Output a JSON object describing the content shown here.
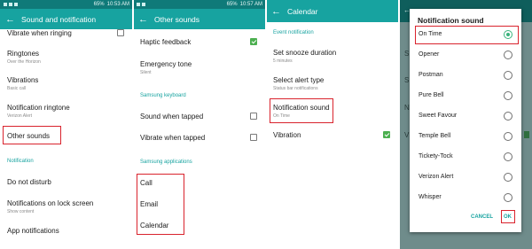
{
  "colors": {
    "status_bar": "#0f7a79",
    "app_bar": "#17a3a0",
    "accent": "#17a3a0",
    "highlight_box": "#d9232d",
    "checkbox_on": "#4caf50",
    "radio_on": "#3bb37d",
    "dim_overlay": "#6f8c8b"
  },
  "panel1": {
    "status": {
      "battery": "65%",
      "time": "10:53 AM"
    },
    "title": "Sound and notification",
    "back_icon": "arrow-left-icon",
    "rows": [
      {
        "label": "Vibrate when ringing",
        "sub": ""
      },
      {
        "label": "Ringtones",
        "sub": "Over the Horizon"
      },
      {
        "label": "Vibrations",
        "sub": "Basic call"
      },
      {
        "label": "Notification ringtone",
        "sub": "Verizon Alert"
      },
      {
        "label": "Other sounds",
        "sub": ""
      }
    ],
    "section": "Notification",
    "rows2": [
      {
        "label": "Do not disturb",
        "sub": ""
      },
      {
        "label": "Notifications on lock screen",
        "sub": "Show content"
      },
      {
        "label": "App notifications",
        "sub": ""
      }
    ]
  },
  "panel2": {
    "status": {
      "battery": "65%",
      "time": "10:57 AM"
    },
    "title": "Other sounds",
    "rows": [
      {
        "label": "Haptic feedback",
        "checked": true
      },
      {
        "label": "Emergency tone",
        "sub": "Silent"
      }
    ],
    "section_keyboard": "Samsung keyboard",
    "keyboard_rows": [
      {
        "label": "Sound when tapped",
        "checked": false
      },
      {
        "label": "Vibrate when tapped",
        "checked": false
      }
    ],
    "section_apps": "Samsung applications",
    "apps": [
      "Call",
      "Email",
      "Calendar"
    ]
  },
  "panel3": {
    "title": "Calendar",
    "section": "Event notification",
    "rows": [
      {
        "label": "Set snooze duration",
        "sub": "5 minutes"
      },
      {
        "label": "Select alert type",
        "sub": "Status bar notifications"
      },
      {
        "label": "Notification sound",
        "sub": "On Time"
      },
      {
        "label": "Vibration",
        "sub": "",
        "checked": true
      }
    ]
  },
  "panel4": {
    "dialog_title": "Notification sound",
    "options": [
      {
        "label": "On Time",
        "selected": true
      },
      {
        "label": "Opener",
        "selected": false
      },
      {
        "label": "Postman",
        "selected": false
      },
      {
        "label": "Pure Bell",
        "selected": false
      },
      {
        "label": "Sweet Favour",
        "selected": false
      },
      {
        "label": "Temple Bell",
        "selected": false
      },
      {
        "label": "Tickety-Tock",
        "selected": false
      },
      {
        "label": "Verizon Alert",
        "selected": false
      },
      {
        "label": "Whisper",
        "selected": false
      }
    ],
    "cancel": "CANCEL",
    "ok": "OK"
  }
}
